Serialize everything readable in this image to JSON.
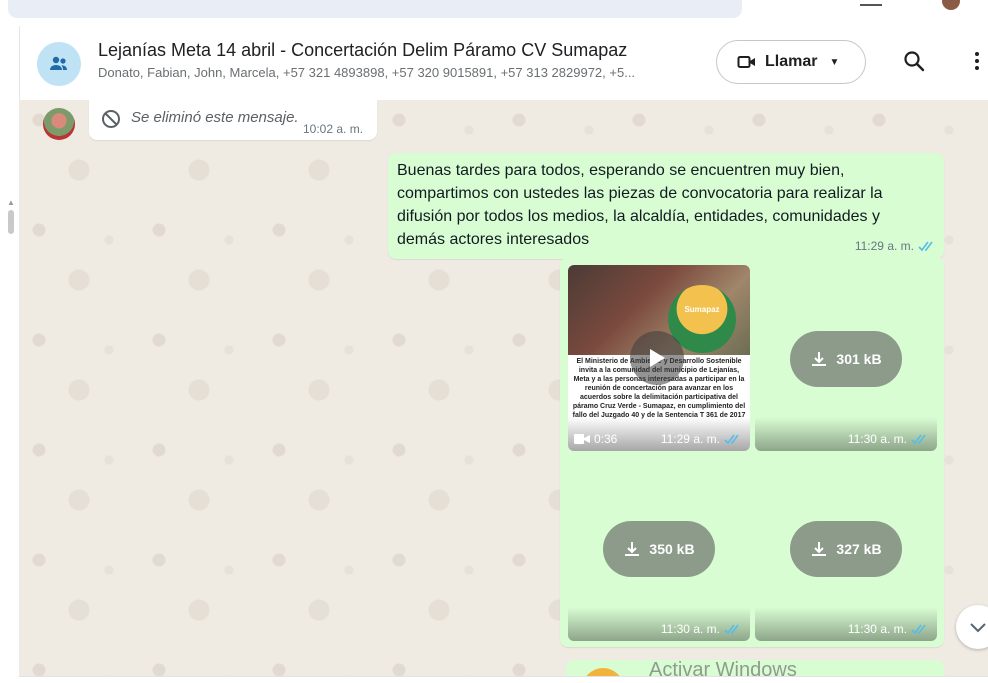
{
  "window": {
    "app": "WhatsApp Web"
  },
  "header": {
    "title": "Lejanías Meta 14 abril - Concertación Delim Páramo CV Sumapaz",
    "participants": "Donato, Fabian, John, Marcela, +57 321 4893898, +57 320 9015891, +57 313 2829972, +5...",
    "call_label": "Llamar",
    "icons": [
      "group-icon",
      "video-call-icon",
      "chevron-down-icon",
      "search-icon",
      "more-vert-icon"
    ]
  },
  "messages": [
    {
      "type": "deleted",
      "direction": "incoming",
      "text": "Se eliminó este mensaje.",
      "time": "10:02 a. m."
    },
    {
      "type": "text",
      "direction": "outgoing",
      "text": "Buenas tardes para todos, esperando se encuentren muy bien, compartimos con ustedes las piezas de convocatoria para realizar la difusión por todos los medios, la alcaldía, entidades, comunidades y demás actores interesados",
      "time": "11:29 a. m.",
      "status": "read"
    }
  ],
  "media_group": {
    "items": [
      {
        "kind": "video",
        "duration": "0:36",
        "time": "11:29 a. m.",
        "poster_logo": "Sumapaz",
        "poster_text": "El Ministerio de Ambiente y Desarrollo Sostenible invita a la comunidad del municipio de Lejanías, Meta y a las personas interesadas a participar en la reunión de concertación para avanzar en los acuerdos sobre la delimitación participativa del páramo Cruz Verde - Sumapaz, en cumplimiento del fallo del Juzgado 40 y de la Sentencia T 361 de 2017"
      },
      {
        "kind": "image",
        "size": "301 kB",
        "time": "11:30 a. m."
      },
      {
        "kind": "image",
        "size": "350 kB",
        "time": "11:30 a. m."
      },
      {
        "kind": "image",
        "size": "327 kB",
        "time": "11:30 a. m."
      }
    ]
  },
  "watermark": "Activar Windows",
  "colors": {
    "outgoing_bubble": "#d9fdd3",
    "incoming_bubble": "#ffffff",
    "chat_background": "#efeae2",
    "read_ticks": "#53bdeb",
    "download_pill": "#8c9b8a"
  }
}
